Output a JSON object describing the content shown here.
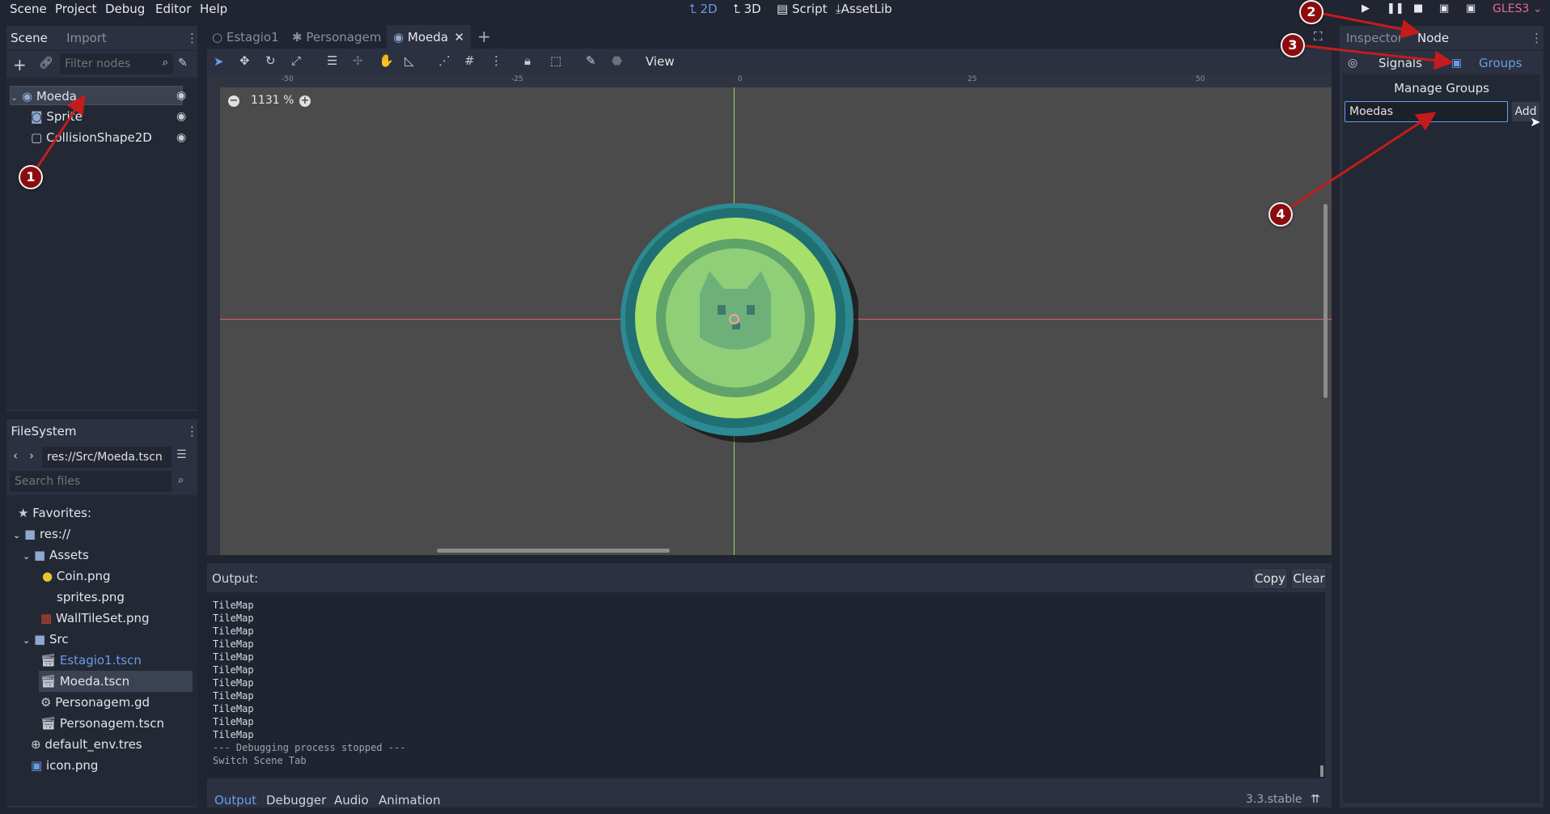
{
  "menu": {
    "scene": "Scene",
    "project": "Project",
    "debug": "Debug",
    "editor": "Editor",
    "help": "Help"
  },
  "workspaces": {
    "two_d": "2D",
    "three_d": "3D",
    "script": "Script",
    "assetlib": "AssetLib"
  },
  "renderer": "GLES3",
  "left_dock": {
    "tabs": {
      "scene": "Scene",
      "import": "Import"
    },
    "filter_placeholder": "Filter nodes",
    "nodes": [
      {
        "label": "Moeda",
        "icon": "coin-node-icon"
      },
      {
        "label": "Sprite",
        "icon": "sprite-icon"
      },
      {
        "label": "CollisionShape2D",
        "icon": "collision-shape-icon"
      }
    ]
  },
  "filesystem": {
    "title": "FileSystem",
    "path": "res://Src/Moeda.tscn",
    "search_placeholder": "Search files",
    "favorites": "Favorites:",
    "root": "res://",
    "assets_folder": "Assets",
    "coin_png": "Coin.png",
    "sprites_png": "sprites.png",
    "walltileset_png": "WallTileSet.png",
    "src_folder": "Src",
    "estagio1_tscn": "Estagio1.tscn",
    "moeda_tscn": "Moeda.tscn",
    "personagem_gd": "Personagem.gd",
    "personagem_tscn": "Personagem.tscn",
    "default_env": "default_env.tres",
    "icon_png": "icon.png"
  },
  "scene_tabs": {
    "estagio1": "Estagio1",
    "personagem": "Personagem",
    "moeda": "Moeda"
  },
  "toolbar": {
    "view": "View"
  },
  "viewport": {
    "zoom": "1131 %",
    "ruler": {
      "m50": "-50",
      "m25": "-25",
      "zero": "0",
      "p25": "25",
      "p50": "50"
    }
  },
  "output": {
    "label": "Output:",
    "copy": "Copy",
    "clear": "Clear",
    "lines": [
      "TileMap",
      "TileMap",
      "TileMap",
      "TileMap",
      "TileMap",
      "TileMap",
      "TileMap",
      "TileMap",
      "TileMap",
      "TileMap",
      "TileMap",
      "--- Debugging process stopped ---",
      "Switch Scene Tab"
    ]
  },
  "bottom_tabs": {
    "output": "Output",
    "debugger": "Debugger",
    "audio": "Audio",
    "animation": "Animation"
  },
  "version": "3.3.stable",
  "right_dock": {
    "tabs": {
      "inspector": "Inspector",
      "node": "Node"
    },
    "signals": "Signals",
    "groups": "Groups",
    "manage_groups": "Manage Groups",
    "group_input_value": "Moedas",
    "add": "Add"
  },
  "annotations": {
    "one": "1",
    "two": "2",
    "three": "3",
    "four": "4"
  },
  "colors": {
    "accent": "#699ce8",
    "annotation_red": "#8b0c0f",
    "renderer": "#e5698c"
  }
}
